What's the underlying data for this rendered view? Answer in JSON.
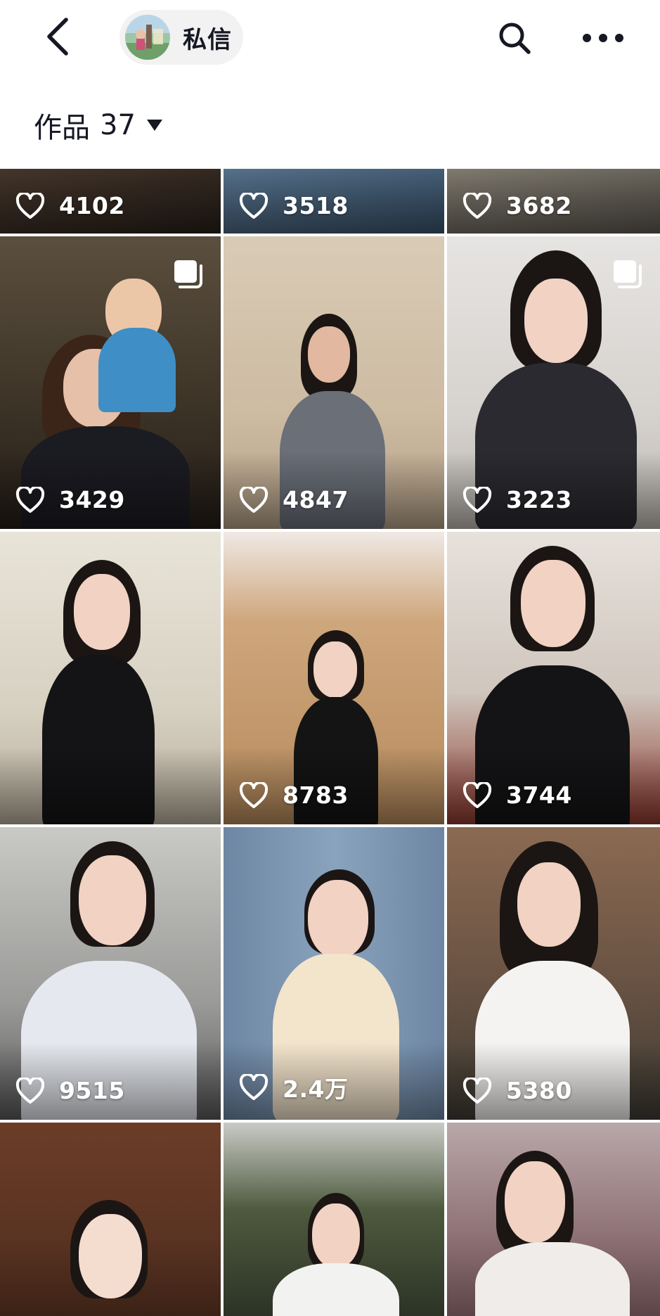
{
  "header": {
    "back_icon": "chevron-left-icon",
    "dm_label": "私信",
    "search_icon": "search-icon",
    "more_icon": "more-horizontal-icon"
  },
  "works": {
    "label": "作品",
    "count": "37",
    "dropdown_icon": "caret-down-icon"
  },
  "grid": {
    "like_icon": "heart-outline-icon",
    "multi_icon": "multi-image-icon",
    "tiles": [
      {
        "likes": "4102",
        "multi": false
      },
      {
        "likes": "3518",
        "multi": false
      },
      {
        "likes": "3682",
        "multi": false
      },
      {
        "likes": "3429",
        "multi": true
      },
      {
        "likes": "4847",
        "multi": false
      },
      {
        "likes": "3223",
        "multi": true
      },
      {
        "likes": "",
        "multi": false
      },
      {
        "likes": "8783",
        "multi": false
      },
      {
        "likes": "3744",
        "multi": false
      },
      {
        "likes": "9515",
        "multi": false
      },
      {
        "likes": "2.4万",
        "multi": false
      },
      {
        "likes": "5380",
        "multi": false
      },
      {
        "likes": "",
        "multi": false
      },
      {
        "likes": "",
        "multi": false
      },
      {
        "likes": "",
        "multi": false
      }
    ]
  },
  "colors": {
    "text": "#161823",
    "pill_bg": "#f2f2f2",
    "overlay_text": "#ffffff"
  }
}
